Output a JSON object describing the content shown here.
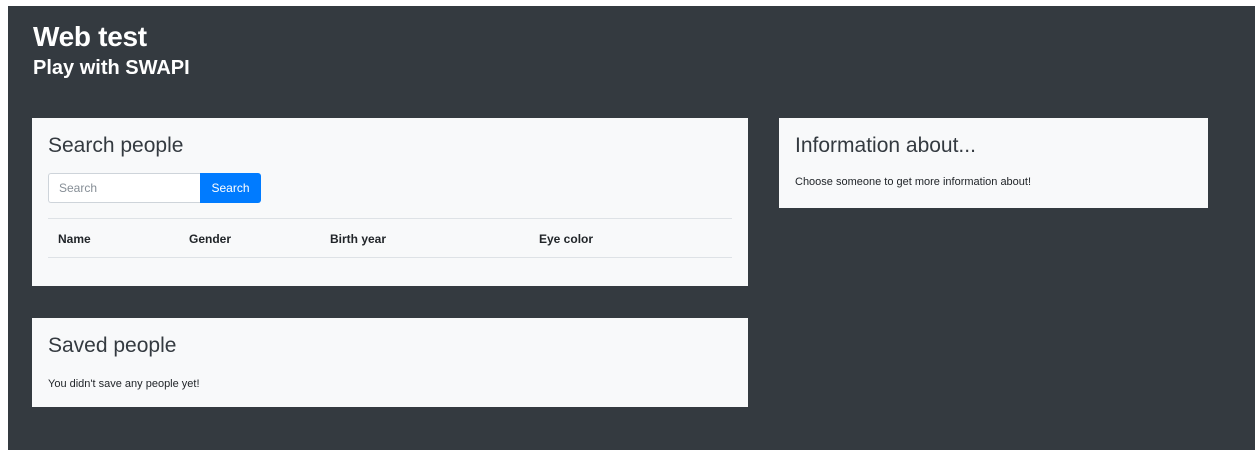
{
  "header": {
    "title": "Web test",
    "subtitle": "Play with SWAPI"
  },
  "search": {
    "heading": "Search people",
    "input_placeholder": "Search",
    "input_value": "",
    "button_label": "Search",
    "table": {
      "columns": [
        "Name",
        "Gender",
        "Birth year",
        "Eye color"
      ],
      "rows": []
    }
  },
  "saved": {
    "heading": "Saved people",
    "empty_text": "You didn't save any people yet!"
  },
  "info": {
    "heading": "Information about...",
    "text": "Choose someone to get more information about!"
  },
  "colors": {
    "background": "#343a40",
    "card": "#f8f9fa",
    "primary": "#007bff"
  }
}
